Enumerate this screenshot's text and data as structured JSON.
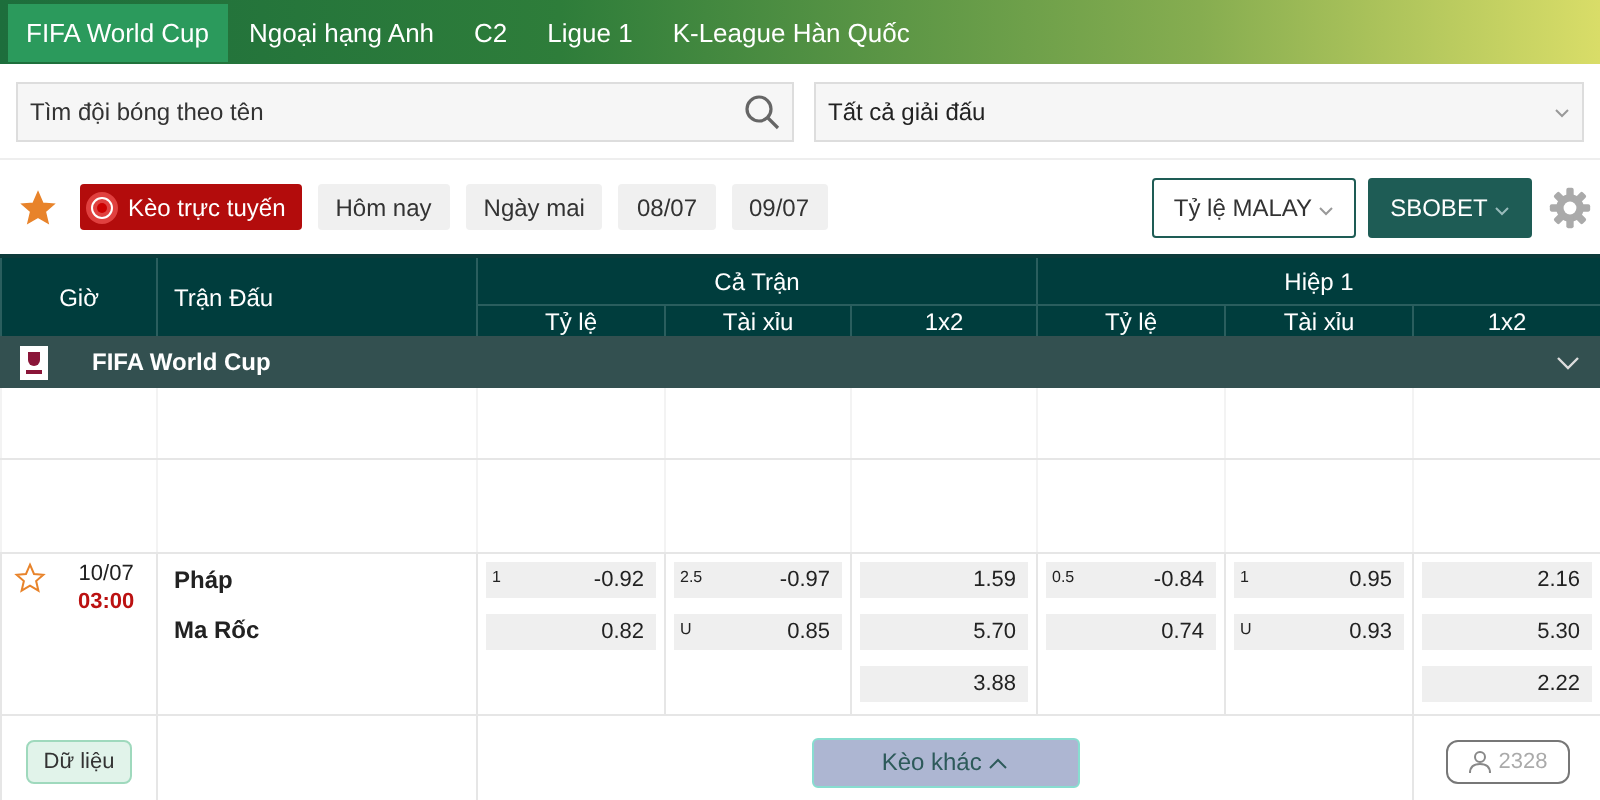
{
  "nav": [
    {
      "label": "FIFA World Cup",
      "selected": true
    },
    {
      "label": "Ngoại hạng Anh",
      "selected": false
    },
    {
      "label": "C2",
      "selected": false
    },
    {
      "label": "Ligue 1",
      "selected": false
    },
    {
      "label": "K-League Hàn Quốc",
      "selected": false
    }
  ],
  "search": {
    "placeholder": "Tìm đội bóng theo tên"
  },
  "league_select": {
    "value": "Tất cả giải đấu"
  },
  "filters": {
    "favorite_on": true,
    "live": {
      "label": "Kèo trực tuyến"
    },
    "dates": [
      {
        "label": "Hôm nay",
        "selected": false
      },
      {
        "label": "Ngày mai",
        "selected": false
      },
      {
        "label": "08/07",
        "selected": false
      },
      {
        "label": "09/07",
        "selected": false
      }
    ],
    "odds_format": "Tỷ lệ MALAY",
    "bookmaker": "SBOBET"
  },
  "table": {
    "col_time": "Giờ",
    "col_match": "Trận Đấu",
    "groups": [
      {
        "title": "Cả Trận",
        "columns": [
          "Tỷ lệ",
          "Tài xỉu",
          "1x2"
        ]
      },
      {
        "title": "Hiệp 1",
        "columns": [
          "Tỷ lệ",
          "Tài xỉu",
          "1x2"
        ]
      }
    ],
    "league": {
      "name": "FIFA World Cup",
      "expanded": true
    },
    "matches": [
      {
        "date": "10/07",
        "time": "03:00",
        "favorite": false,
        "home": "Pháp",
        "away": "Ma Rốc",
        "odds": [
          [
            {
              "line": "1",
              "value": "-0.92"
            },
            {
              "value": "0.82"
            }
          ],
          [
            {
              "line": "2.5",
              "value": "-0.97"
            },
            {
              "line": "U",
              "value": "0.85"
            }
          ],
          [
            {
              "value": "1.59"
            },
            {
              "value": "5.70"
            },
            {
              "value": "3.88"
            }
          ],
          [
            {
              "line": "0.5",
              "value": "-0.84"
            },
            {
              "value": "0.74"
            }
          ],
          [
            {
              "line": "1",
              "value": "0.95"
            },
            {
              "line": "U",
              "value": "0.93"
            }
          ],
          [
            {
              "value": "2.16"
            },
            {
              "value": "5.30"
            },
            {
              "value": "2.22"
            }
          ]
        ],
        "data_button": "Dữ liệu",
        "more_button": "Kèo khác",
        "viewers": "2328"
      }
    ]
  }
}
